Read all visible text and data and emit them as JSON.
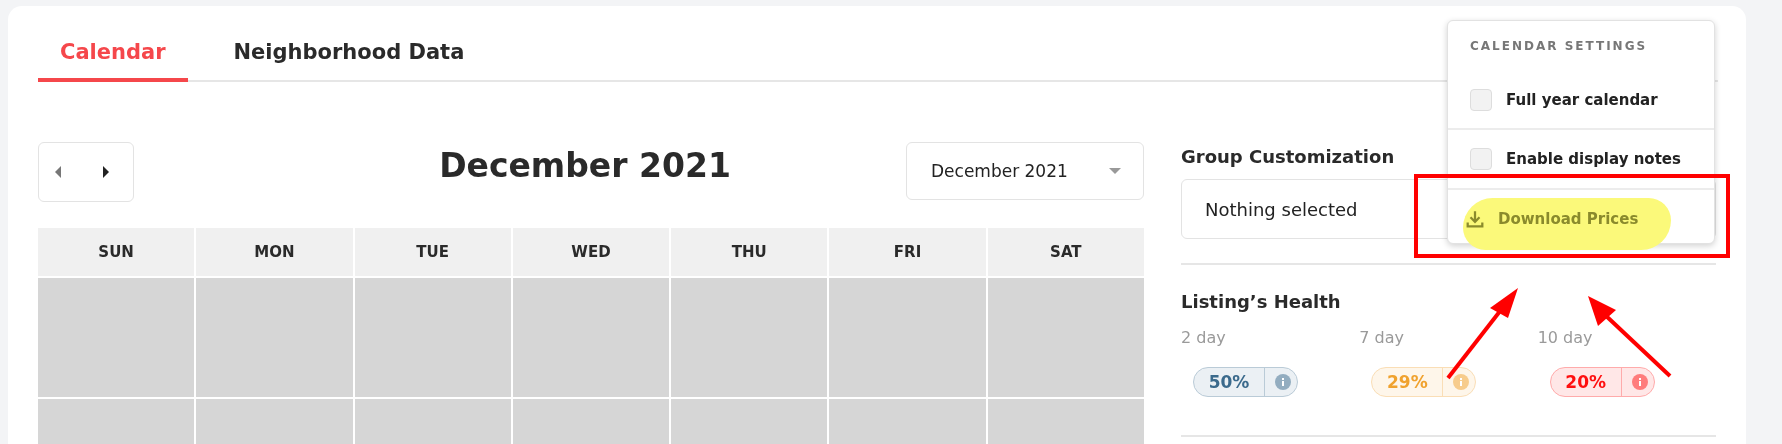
{
  "tabs": [
    {
      "label": "Calendar",
      "selected": true
    },
    {
      "label": "Neighborhood Data",
      "selected": false
    }
  ],
  "calendar": {
    "title": "December 2021",
    "month_select": {
      "value": "December 2021"
    },
    "weekdays": [
      "SUN",
      "MON",
      "TUE",
      "WED",
      "THU",
      "FRI",
      "SAT"
    ]
  },
  "group_customization": {
    "title": "Group Customization",
    "select": {
      "placeholder": "Nothing selected"
    }
  },
  "listing_health": {
    "title": "Listing’s Health",
    "items": [
      {
        "label": "2 day",
        "value": "50%",
        "color": "#3b6a8c"
      },
      {
        "label": "7 day",
        "value": "29%",
        "color": "#f0a22e"
      },
      {
        "label": "10 day",
        "value": "20%",
        "color": "#ff1010"
      }
    ]
  },
  "calendar_settings": {
    "title": "CALENDAR SETTINGS",
    "options": [
      {
        "label": "Full year calendar",
        "checked": false
      },
      {
        "label": "Enable display notes",
        "checked": false
      }
    ],
    "action": "Download Prices"
  }
}
